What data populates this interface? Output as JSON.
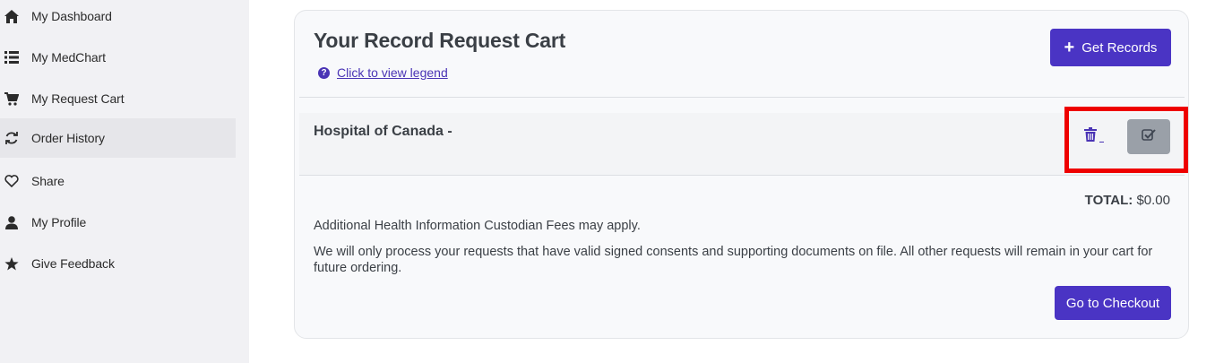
{
  "sidebar": {
    "items": [
      {
        "label": "My Dashboard",
        "icon": "home-icon"
      },
      {
        "label": "My MedChart",
        "icon": "list-icon"
      },
      {
        "label": "My Request Cart",
        "icon": "cart-icon"
      },
      {
        "label": "Order History",
        "icon": "refresh-icon",
        "active": true
      },
      {
        "label": "Share",
        "icon": "heart-icon"
      },
      {
        "label": "My Profile",
        "icon": "user-icon"
      },
      {
        "label": "Give Feedback",
        "icon": "star-icon"
      }
    ]
  },
  "cart": {
    "title": "Your Record Request Cart",
    "legend_link": "Click to view legend",
    "get_records_label": "Get Records",
    "item": {
      "name": "Hospital of Canada -"
    },
    "total_label": "TOTAL:",
    "total_value": "$0.00",
    "fees_note": "Additional Health Information Custodian Fees may apply.",
    "process_note": "We will only process your requests that have valid signed consents and supporting documents on file. All other requests will remain in your cart for future ordering.",
    "checkout_label": "Go to Checkout"
  },
  "colors": {
    "primary": "#4a34c4",
    "highlight": "#ee0000",
    "sidebar_bg": "#f1f1f4"
  }
}
